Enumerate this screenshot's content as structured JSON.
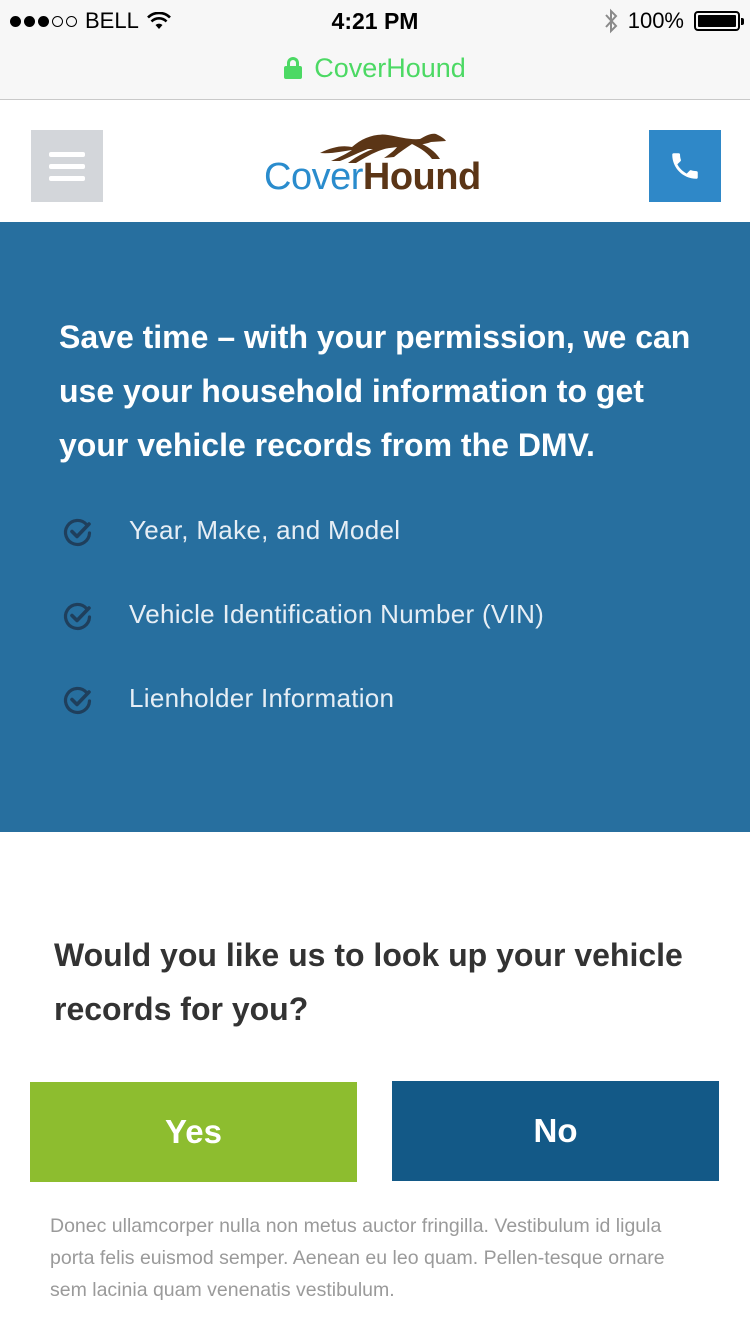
{
  "status_bar": {
    "carrier": "BELL",
    "time": "4:21 PM",
    "battery": "100%",
    "icons": [
      "signal-dots-icon",
      "wifi-icon",
      "bluetooth-icon",
      "battery-icon"
    ]
  },
  "url_bar": {
    "site": "CoverHound",
    "secure_icon": "lock-icon",
    "color": "#4cd964"
  },
  "header": {
    "logo": {
      "part1": "Cover",
      "part2": "Hound"
    },
    "menu_icon": "hamburger-menu-icon",
    "phone_icon": "phone-icon"
  },
  "hero": {
    "title": "Save time – with your permission, we can use your household information to get your vehicle records from the DMV.",
    "features": [
      {
        "label": "Year, Make, and Model",
        "icon": "check-circle-icon"
      },
      {
        "label": "Vehicle Identification Number (VIN)",
        "icon": "check-circle-icon"
      },
      {
        "label": "Lienholder Information",
        "icon": "check-circle-icon"
      }
    ],
    "background": "#276f9f"
  },
  "question": {
    "text": "Would you like us to look up your vehicle records for you?"
  },
  "buttons": {
    "yes": {
      "label": "Yes",
      "color": "#8dbd2f"
    },
    "no": {
      "label": "No",
      "color": "#135987"
    }
  },
  "disclaimer": "Donec ullamcorper nulla non metus auctor fringilla. Vestibulum id ligula porta felis euismod semper. Aenean eu leo quam. Pellen-tesque ornare sem lacinia quam venenatis vestibulum."
}
